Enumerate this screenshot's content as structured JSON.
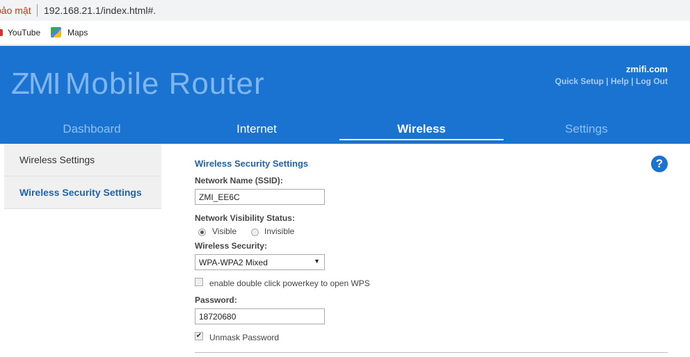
{
  "browser": {
    "security_label": "bảo mật",
    "url": "192.168.21.1/index.html#.",
    "bookmarks": [
      {
        "label": "YouTube",
        "icon": "youtube-icon"
      },
      {
        "label": "Maps",
        "icon": "maps-icon"
      }
    ]
  },
  "header": {
    "logo_mark": "ZMI",
    "logo_text": "Mobile Router",
    "site": "zmifi.com",
    "links": [
      "Quick Setup",
      "Help",
      "Log Out"
    ],
    "separator": " | "
  },
  "tabs": [
    {
      "label": "Dashboard"
    },
    {
      "label": "Internet"
    },
    {
      "label": "Wireless",
      "active": true
    },
    {
      "label": "Settings"
    }
  ],
  "sidebar": {
    "items": [
      {
        "label": "Wireless Settings"
      },
      {
        "label": "Wireless Security Settings",
        "active": true
      }
    ]
  },
  "form": {
    "title": "Wireless Security Settings",
    "ssid_label": "Network Name (SSID):",
    "ssid_value": "ZMI_EE6C",
    "visibility_label": "Network Visibility Status:",
    "visible_label": "Visible",
    "invisible_label": "Invisible",
    "visibility": "Visible",
    "security_label": "Wireless Security:",
    "security_value": "WPA-WPA2 Mixed",
    "wps_label": "enable double click powerkey to open WPS",
    "wps_checked": false,
    "password_label": "Password:",
    "password_value": "18720680",
    "unmask_label": "Unmask Password",
    "unmask_checked": true
  },
  "help_icon": "?",
  "colors": {
    "brand": "#1b73d1",
    "link": "#1f63a8"
  }
}
